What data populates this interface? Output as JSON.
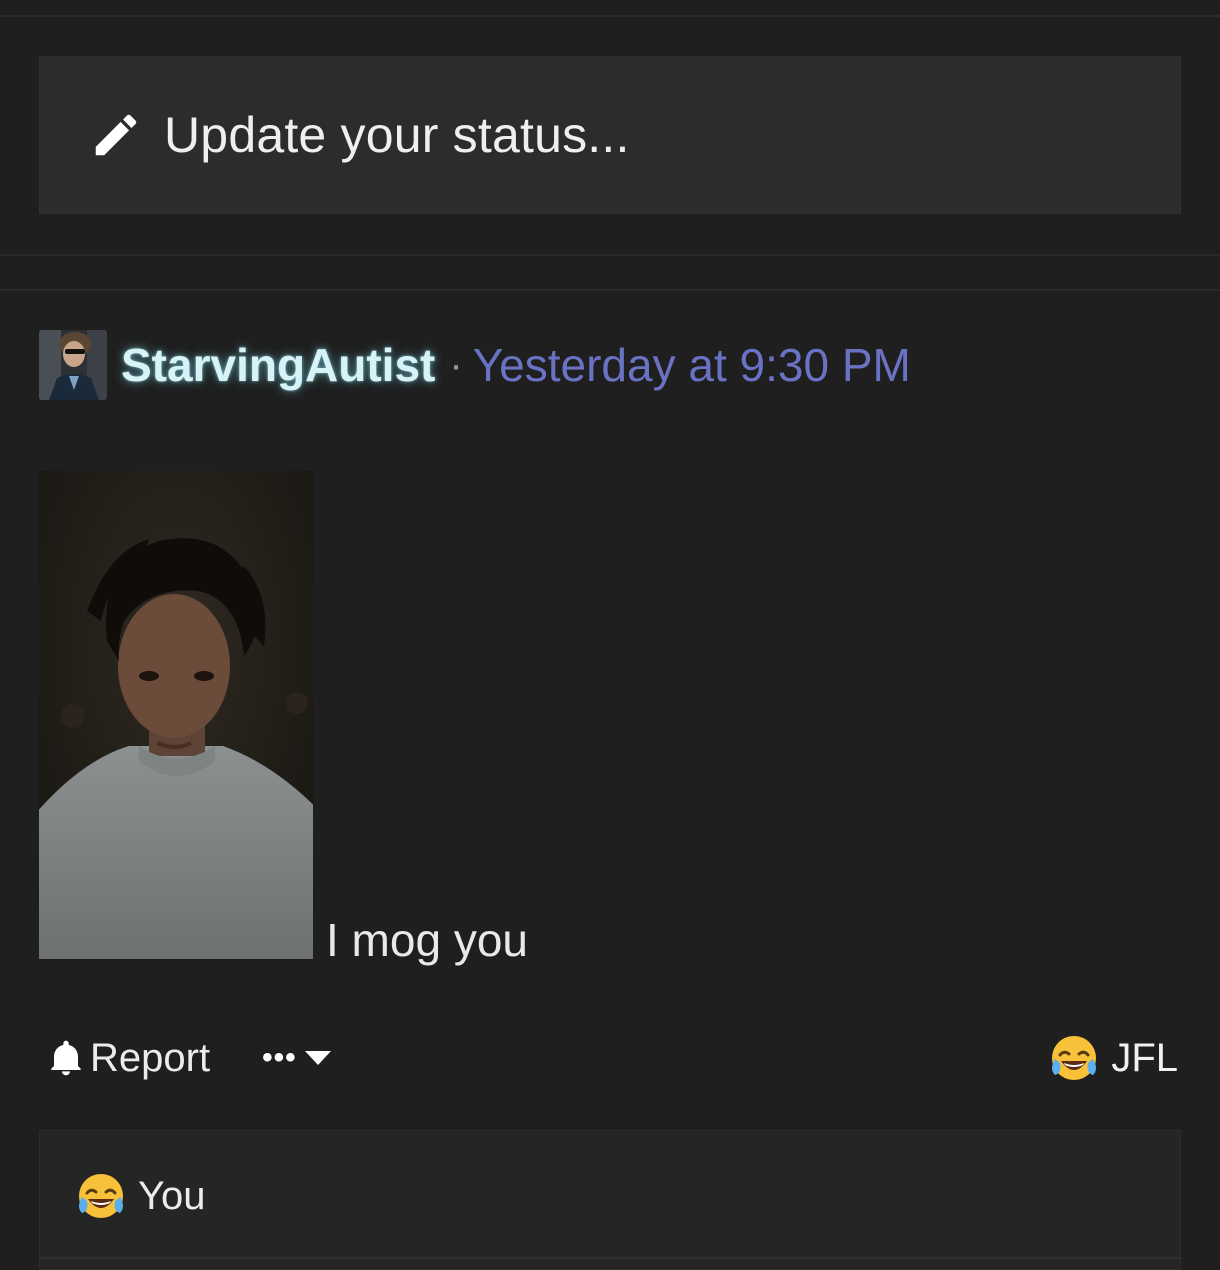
{
  "status_box": {
    "placeholder": "Update your status...",
    "icon": "pencil-icon"
  },
  "post": {
    "author": "StarvingAutist",
    "separator": "·",
    "timestamp": "Yesterday at 9:30 PM",
    "text": "I mog you",
    "colors": {
      "username": "#d8f3f5",
      "timestamp": "#6a72c4"
    }
  },
  "actions": {
    "report_label": "Report",
    "report_icon": "bell-icon",
    "more_label": "•••",
    "more_icon": "caret-down-icon"
  },
  "reaction_summary": {
    "emoji": "laughing-crying-emoji",
    "label": "JFL"
  },
  "reaction_list": {
    "emoji": "laughing-crying-emoji",
    "label": "You"
  }
}
